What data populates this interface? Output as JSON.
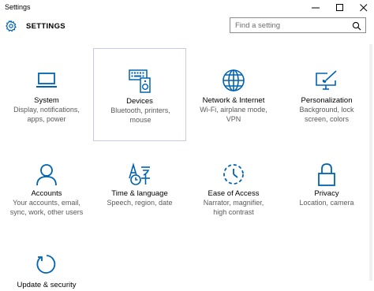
{
  "window": {
    "title": "Settings",
    "minimize": "minimize",
    "maximize": "maximize",
    "close": "close"
  },
  "header": {
    "title": "SETTINGS",
    "icon": "gear-icon"
  },
  "search": {
    "placeholder": "Find a setting",
    "icon": "search-icon"
  },
  "accent_color": "#0063b1",
  "tiles": [
    {
      "name": "System",
      "desc_lines": [
        "Display, notifications,",
        "apps, power"
      ],
      "icon": "laptop-icon"
    },
    {
      "name": "Devices",
      "desc_lines": [
        "Bluetooth, printers,",
        "mouse"
      ],
      "icon": "keyboard-speaker-icon"
    },
    {
      "name": "Network & Internet",
      "desc_lines": [
        "Wi-Fi, airplane mode,",
        "VPN"
      ],
      "icon": "globe-icon"
    },
    {
      "name": "Personalization",
      "desc_lines": [
        "Background, lock",
        "screen, colors"
      ],
      "icon": "paint-monitor-icon"
    },
    {
      "name": "Accounts",
      "desc_lines": [
        "Your accounts, email,",
        "sync, work, other users"
      ],
      "icon": "person-icon"
    },
    {
      "name": "Time & language",
      "desc_lines": [
        "Speech, region, date"
      ],
      "icon": "time-language-icon"
    },
    {
      "name": "Ease of Access",
      "desc_lines": [
        "Narrator, magnifier,",
        "high contrast"
      ],
      "icon": "ease-of-access-icon"
    },
    {
      "name": "Privacy",
      "desc_lines": [
        "Location, camera"
      ],
      "icon": "lock-icon"
    },
    {
      "name": "Update & security",
      "desc_lines": [],
      "icon": "refresh-icon"
    }
  ]
}
